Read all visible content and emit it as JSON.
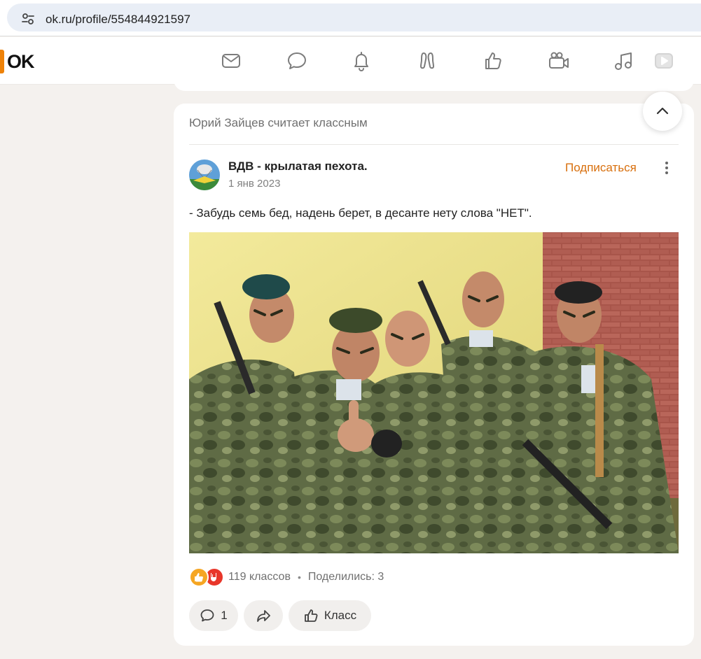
{
  "browser": {
    "url": "ok.ru/profile/554844921597"
  },
  "header": {
    "logo_text": "OK",
    "nav_icons": [
      "messages-icon",
      "discussions-icon",
      "notifications-icon",
      "guests-icon",
      "events-icon",
      "video-icon",
      "music-icon",
      "video-player-icon"
    ]
  },
  "post": {
    "context": "Юрий Зайцев считает классным",
    "author": "ВДВ - крылатая пехота.",
    "date": "1 янв 2023",
    "subscribe_label": "Подписаться",
    "text": "- Забудь семь бед, надень берет, в десанте нету слова \"НЕТ\".",
    "reactions": {
      "likes": "119 классов",
      "separator": "•",
      "shares": "Поделились: 3"
    },
    "actions": {
      "comment_count": "1",
      "class_label": "Класс"
    }
  },
  "colors": {
    "accent": "#ee8208",
    "subscribe": "#d86f0d",
    "page_bg": "#f4f1ee"
  }
}
